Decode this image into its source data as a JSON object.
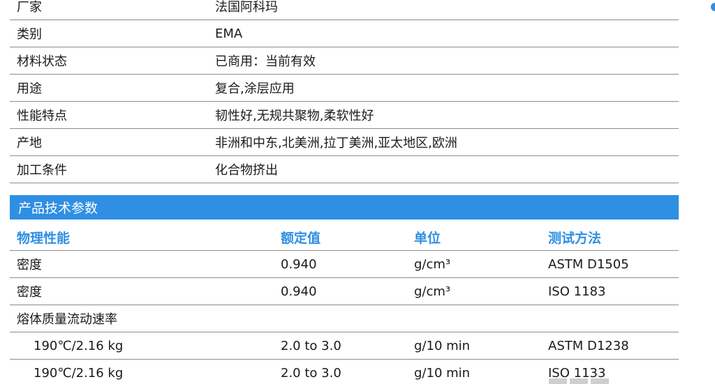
{
  "info": [
    {
      "label": "厂家",
      "value": "法国阿科玛"
    },
    {
      "label": "类别",
      "value": "EMA"
    },
    {
      "label": "材料状态",
      "value": "已商用：当前有效"
    },
    {
      "label": "用途",
      "value": "复合,涂层应用"
    },
    {
      "label": "性能特点",
      "value": "韧性好,无规共聚物,柔软性好"
    },
    {
      "label": "产地",
      "value": "非洲和中东,北美洲,拉丁美洲,亚太地区,欧洲"
    },
    {
      "label": "加工条件",
      "value": "化合物挤出"
    }
  ],
  "section": {
    "title": "产品技术参数"
  },
  "spec_headers": {
    "property": "物理性能",
    "value": "额定值",
    "unit": "单位",
    "method": "测试方法"
  },
  "spec_rows": [
    {
      "property": "密度",
      "value": "0.940",
      "unit": "g/cm³",
      "method": "ASTM D1505"
    },
    {
      "property": "密度",
      "value": "0.940",
      "unit": "g/cm³",
      "method": "ISO 1183"
    },
    {
      "property": "熔体质量流动速率",
      "value": "",
      "unit": "",
      "method": ""
    },
    {
      "property": "190℃/2.16 kg",
      "value": "2.0 to 3.0",
      "unit": "g/10 min",
      "method": "ASTM D1238"
    },
    {
      "property": "190℃/2.16 kg",
      "value": "2.0 to 3.0",
      "unit": "g/10 min",
      "method": "ISO 1133"
    }
  ],
  "colors": {
    "accent": "#2f8fe3",
    "rule": "#8c8c8c"
  }
}
